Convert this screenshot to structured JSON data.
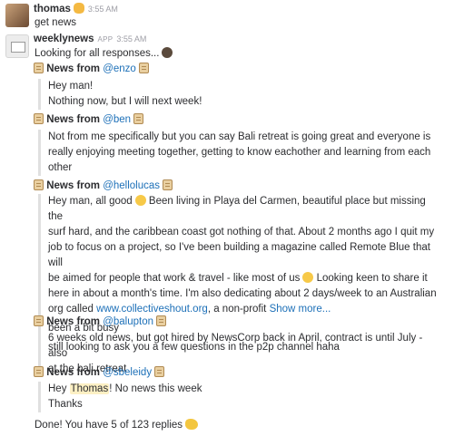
{
  "messages": [
    {
      "user": "thomas",
      "time": "3:55 AM",
      "text": "get news"
    },
    {
      "user": "weeklynews",
      "tag": "APP",
      "time": "3:55 AM",
      "text": "Looking for all responses..."
    }
  ],
  "news": [
    {
      "prefix": "News from ",
      "mention": "@enzo",
      "lines": [
        "Hey man!",
        "Nothing now, but I will next week!"
      ]
    },
    {
      "prefix": "News from ",
      "mention": "@ben",
      "lines": [
        "Not from me specifically but you can say Bali retreat is going great and everyone is",
        "really enjoying meeting together, getting to know eachother and learning from each",
        "other"
      ]
    },
    {
      "prefix": "News from ",
      "mention": "@hellolucas",
      "lines": [
        "Hey man, all good",
        "Been living in Playa del Carmen, beautiful place but missing the",
        "surf hard, and the caribbean coast got nothing of that. About 2 months ago I quit my",
        "job to focus on a project, so I've been building a magazine called Remote Blue that will",
        "be aimed for people that work & travel - like most of us",
        "Looking keen to share it",
        "here in about a month's time. I'm also dedicating about 2 days/week to an Australian",
        "org called",
        "www.collectiveshout.org",
        ", a non-profit",
        "Show more..."
      ],
      "extra": [
        "been a bit busy",
        "still looking to ask you a few questions in the p2p channel haha"
      ]
    },
    {
      "prefix": "News from ",
      "mention": "@balupton",
      "lines": [
        "6 weeks old news, but got hired by NewsCorp back in April, contract is until July - also",
        "at the bali retreat"
      ]
    },
    {
      "prefix": "News from ",
      "mention": "@sbeleidy",
      "lines": [
        "Hey",
        "Thomas",
        "! No news this week",
        "Thanks"
      ]
    }
  ],
  "footer": "Done! You have 5 of 123 replies"
}
